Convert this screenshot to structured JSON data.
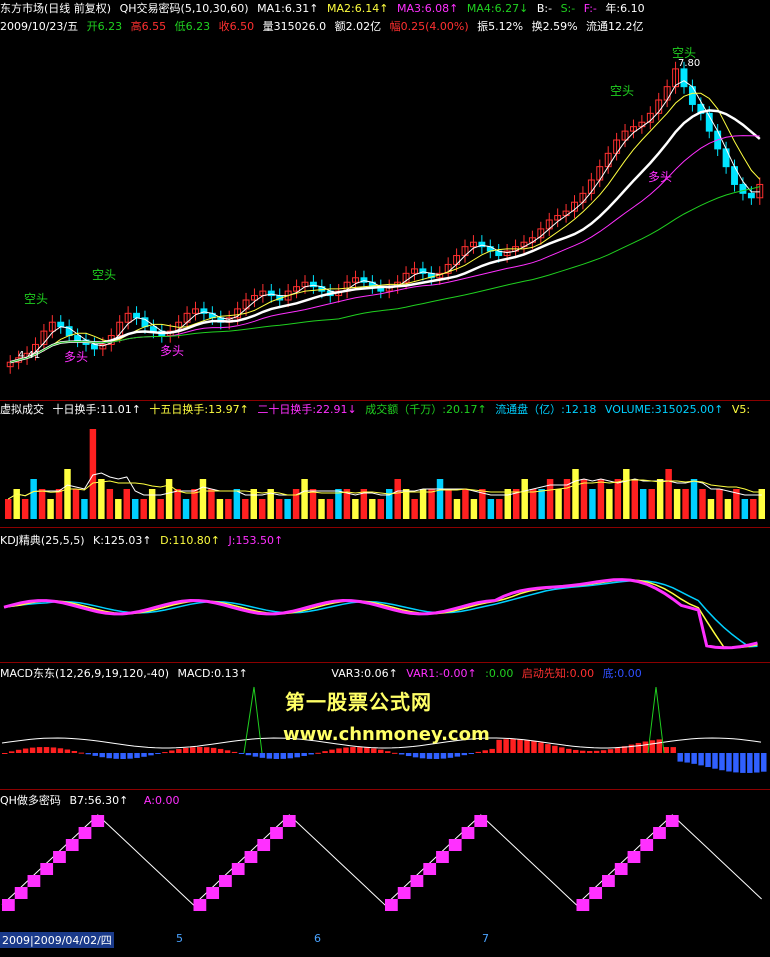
{
  "colors": {
    "up": "#ff3030",
    "down": "#00e5ff",
    "white": "#ffffff",
    "yellow": "#ffff40",
    "magenta": "#ff30ff",
    "green": "#20d020",
    "cyan": "#00d0ff",
    "red": "#ff2020"
  },
  "price_panel": {
    "title_line1": [
      "东方市场(日线 前复权)",
      "QH交易密码(5,10,30,60)",
      "MA1:6.31↑",
      "MA2:6.14↑",
      "MA3:6.08↑",
      "MA4:6.27↓",
      "B:-",
      "S:-",
      "F:-",
      "年:6.10"
    ],
    "title_line2": [
      "2009/10/23/五",
      "开6.23",
      "高6.55",
      "低6.23",
      "收6.50",
      "量315026.0",
      "额2.02亿",
      "幅0.25(4.00%)",
      "振5.12%",
      "换2.59%",
      "流通12.2亿"
    ],
    "price_low": "4.41",
    "price_high": "7.80",
    "labels_kong": [
      "空头",
      "空头",
      "空头",
      "空头"
    ],
    "labels_duo": [
      "多头",
      "多头",
      "多头"
    ]
  },
  "volume_panel": {
    "title": [
      "虚拟成交",
      "十日换手:11.01↑",
      "十五日换手:13.97↑",
      "二十日换手:22.91↓",
      "成交额（千万）:20.17↑",
      "流通盘（亿）:12.18",
      "VOLUME:315025.00↑",
      "V5:"
    ]
  },
  "kdj_panel": {
    "title": [
      "KDJ精典(25,5,5)",
      "K:125.03↑",
      "D:110.80↑",
      "J:153.50↑"
    ]
  },
  "macd_panel": {
    "title": [
      "MACD东东(12,26,9,19,120,-40)",
      "MACD:0.13↑",
      "VAR3:0.06↑",
      "VAR1:-0.00↑",
      ":0.00",
      "启动先知:0.00",
      "底:0.00"
    ]
  },
  "qh_panel": {
    "title": [
      "QH做多密码",
      "B7:56.30↑",
      "A:0.00"
    ]
  },
  "watermark": {
    "line1": "第一股票公式网",
    "line2": "www.chnmoney.com"
  },
  "x_axis": {
    "date": "2009|2009/04/02/四",
    "ticks": [
      "5",
      "6",
      "7"
    ]
  },
  "chart_data": [
    {
      "type": "candlestick",
      "title": "东方市场(日线 前复权)",
      "annotations": [
        "4.41",
        "7.80"
      ],
      "series": [
        {
          "name": "MA1",
          "last": 6.31
        },
        {
          "name": "MA2",
          "last": 6.14
        },
        {
          "name": "MA3",
          "last": 6.08
        },
        {
          "name": "MA4",
          "last": 6.27
        }
      ],
      "closes": [
        4.5,
        4.55,
        4.6,
        4.7,
        4.85,
        4.95,
        4.9,
        4.8,
        4.75,
        4.7,
        4.65,
        4.7,
        4.8,
        4.95,
        5.05,
        5.0,
        4.9,
        4.85,
        4.8,
        4.85,
        4.95,
        5.05,
        5.1,
        5.05,
        5.0,
        4.95,
        5.0,
        5.1,
        5.2,
        5.25,
        5.3,
        5.25,
        5.2,
        5.3,
        5.35,
        5.4,
        5.35,
        5.3,
        5.25,
        5.3,
        5.4,
        5.45,
        5.4,
        5.35,
        5.3,
        5.35,
        5.4,
        5.5,
        5.55,
        5.5,
        5.45,
        5.5,
        5.6,
        5.7,
        5.8,
        5.85,
        5.8,
        5.75,
        5.7,
        5.75,
        5.8,
        5.85,
        5.9,
        6.0,
        6.1,
        6.15,
        6.2,
        6.3,
        6.4,
        6.55,
        6.7,
        6.85,
        7.0,
        7.1,
        7.15,
        7.2,
        7.3,
        7.45,
        7.6,
        7.8,
        7.6,
        7.4,
        7.3,
        7.1,
        6.9,
        6.7,
        6.5,
        6.4,
        6.35,
        6.5
      ],
      "last_bar": {
        "date": "2009/10/23",
        "open": 6.23,
        "high": 6.55,
        "low": 6.23,
        "close": 6.5
      }
    },
    {
      "type": "bar",
      "title": "虚拟成交",
      "values": [
        2,
        3,
        2,
        4,
        3,
        2,
        3,
        5,
        3,
        2,
        9,
        4,
        3,
        2,
        3,
        2,
        2,
        3,
        2,
        4,
        3,
        2,
        3,
        4,
        3,
        2,
        2,
        3,
        2,
        3,
        2,
        3,
        2,
        2,
        3,
        4,
        3,
        2,
        2,
        3,
        3,
        2,
        3,
        2,
        2,
        3,
        4,
        3,
        2,
        3,
        3,
        4,
        3,
        2,
        3,
        2,
        3,
        2,
        2,
        3,
        3,
        4,
        3,
        3,
        4,
        3,
        4,
        5,
        4,
        3,
        4,
        3,
        4,
        5,
        4,
        3,
        3,
        4,
        5,
        3,
        3,
        4,
        3,
        2,
        3,
        2,
        3,
        2,
        2,
        3
      ]
    },
    {
      "type": "line",
      "title": "KDJ精典(25,5,5)",
      "series": [
        {
          "name": "K",
          "last": 125.03
        },
        {
          "name": "D",
          "last": 110.8
        },
        {
          "name": "J",
          "last": 153.5
        }
      ]
    },
    {
      "type": "bar",
      "title": "MACD东东(12,26,9,19,120,-40)",
      "series": [
        {
          "name": "MACD",
          "last": 0.13
        }
      ]
    },
    {
      "type": "line",
      "title": "QH做多密码",
      "series": [
        {
          "name": "B7",
          "last": 56.3
        },
        {
          "name": "A",
          "last": 0.0
        }
      ]
    }
  ]
}
